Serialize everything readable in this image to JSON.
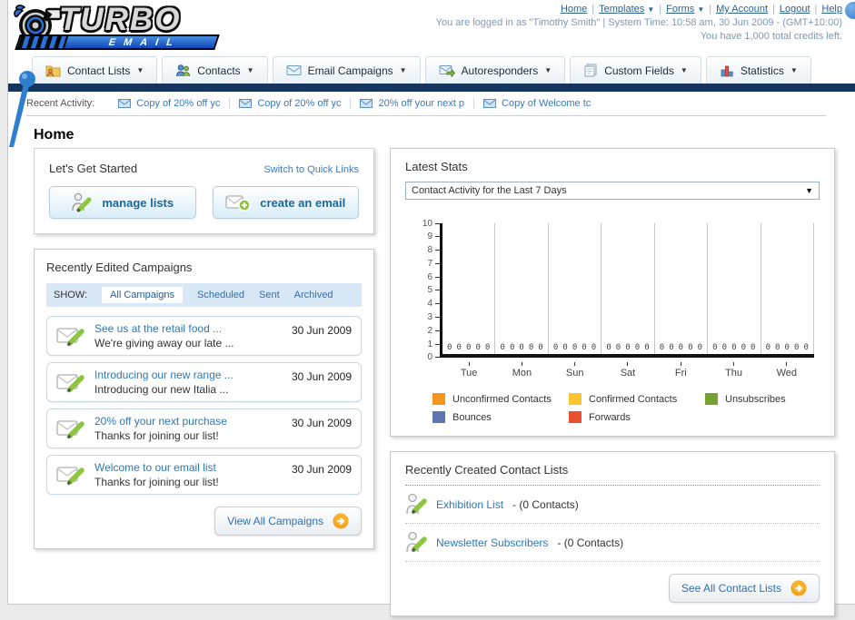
{
  "header": {
    "logo": {
      "word1": "TURBO",
      "word2": "EMAIL"
    },
    "nav_links": [
      {
        "label": "Home",
        "dropdown": false
      },
      {
        "label": "Templates",
        "dropdown": true
      },
      {
        "label": "Forms",
        "dropdown": true
      },
      {
        "label": "My Account",
        "dropdown": false
      },
      {
        "label": "Logout",
        "dropdown": false
      },
      {
        "label": "Help",
        "dropdown": false
      }
    ],
    "login_info": "You are logged in as \"Timothy Smith\" | System Time: 10:58 am, 30 Jun 2009 - (GMT+10:00)",
    "credits_info": "You have 1,000 total credits left."
  },
  "tabs": [
    {
      "label": "Contact Lists",
      "icon": "folder-contacts-icon"
    },
    {
      "label": "Contacts",
      "icon": "contacts-icon"
    },
    {
      "label": "Email Campaigns",
      "icon": "envelope-icon"
    },
    {
      "label": "Autoresponders",
      "icon": "envelope-arrow-icon"
    },
    {
      "label": "Custom Fields",
      "icon": "pages-icon"
    },
    {
      "label": "Statistics",
      "icon": "bar-chart-icon"
    }
  ],
  "recent_activity": {
    "label": "Recent Activity:",
    "items": [
      "Copy of 20% off yc",
      "Copy of 20% off yc",
      "20% off your next p",
      "Copy of Welcome tc"
    ]
  },
  "page_title": "Home",
  "get_started": {
    "title": "Let's Get Started",
    "switch_link": "Switch to Quick Links",
    "manage_lists_label": "manage lists",
    "create_email_label": "create an email"
  },
  "campaigns": {
    "title": "Recently Edited Campaigns",
    "show_label": "SHOW:",
    "filters": [
      "All Campaigns",
      "Scheduled",
      "Sent",
      "Archived"
    ],
    "active_filter": "All Campaigns",
    "items": [
      {
        "title": "See us at the retail food ...",
        "subtitle": "We're giving away our late ...",
        "date": "30 Jun 2009"
      },
      {
        "title": "Introducing our new range ...",
        "subtitle": "Introducing our new Italia ...",
        "date": "30 Jun 2009"
      },
      {
        "title": "20% off your next purchase",
        "subtitle": "Thanks for joining our list!",
        "date": "30 Jun 2009"
      },
      {
        "title": "Welcome to our email list",
        "subtitle": "Thanks for joining our list!",
        "date": "30 Jun 2009"
      }
    ],
    "view_all_label": "View All Campaigns"
  },
  "stats": {
    "title": "Latest Stats",
    "dropdown_value": "Contact Activity for the Last 7 Days"
  },
  "chart_data": {
    "type": "bar",
    "title": "Contact Activity for the Last 7 Days",
    "categories": [
      "Tue",
      "Mon",
      "Sun",
      "Sat",
      "Fri",
      "Thu",
      "Wed"
    ],
    "series": [
      {
        "name": "Unconfirmed Contacts",
        "color": "#F7941E",
        "values": [
          0,
          0,
          0,
          0,
          0,
          0,
          0
        ]
      },
      {
        "name": "Confirmed Contacts",
        "color": "#FDC431",
        "values": [
          0,
          0,
          0,
          0,
          0,
          0,
          0
        ]
      },
      {
        "name": "Unsubscribes",
        "color": "#74A32F",
        "values": [
          0,
          0,
          0,
          0,
          0,
          0,
          0
        ]
      },
      {
        "name": "Bounces",
        "color": "#5B76B0",
        "values": [
          0,
          0,
          0,
          0,
          0,
          0,
          0
        ]
      },
      {
        "name": "Forwards",
        "color": "#E8502E",
        "values": [
          0,
          0,
          0,
          0,
          0,
          0,
          0
        ]
      }
    ],
    "ylim": [
      0,
      10
    ],
    "yticks": [
      0,
      1,
      2,
      3,
      4,
      5,
      6,
      7,
      8,
      9,
      10
    ],
    "grid": "vertical",
    "legend_position": "bottom"
  },
  "contact_lists": {
    "title": "Recently Created Contact Lists",
    "items": [
      {
        "name": "Exhibition List",
        "count": "- (0 Contacts)"
      },
      {
        "name": "Newsletter Subscribers",
        "count": "- (0 Contacts)"
      }
    ],
    "see_all_label": "See All Contact Lists"
  }
}
